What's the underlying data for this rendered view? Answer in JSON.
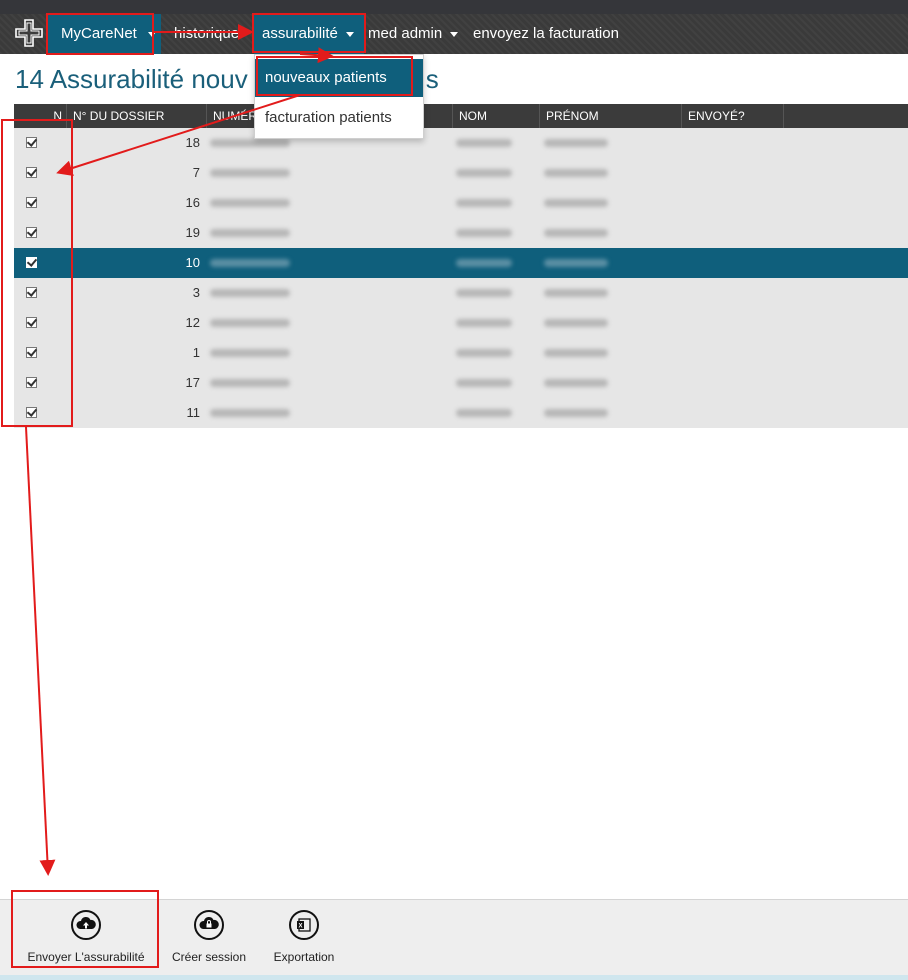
{
  "nav": {
    "brand": "MyCareNet",
    "items": [
      {
        "label": "historique"
      },
      {
        "label": "assurabilité"
      },
      {
        "label": "med admin"
      },
      {
        "label": "envoyez la facturation"
      }
    ]
  },
  "dropdown": {
    "items": [
      "nouveaux patients",
      "facturation patients"
    ]
  },
  "page_title": "14 Assurabilité nouv",
  "page_title_tail": "s",
  "table": {
    "columns": [
      "N",
      "N° DU DOSSIER",
      "NUMÉR",
      "NOM",
      "PRÉNOM",
      "ENVOYÉ?"
    ],
    "rows": [
      {
        "dossier": "18",
        "selected": false
      },
      {
        "dossier": "7",
        "selected": false
      },
      {
        "dossier": "16",
        "selected": false
      },
      {
        "dossier": "19",
        "selected": false
      },
      {
        "dossier": "10",
        "selected": true
      },
      {
        "dossier": "3",
        "selected": false
      },
      {
        "dossier": "12",
        "selected": false
      },
      {
        "dossier": "1",
        "selected": false
      },
      {
        "dossier": "17",
        "selected": false
      },
      {
        "dossier": "11",
        "selected": false
      }
    ]
  },
  "toolbar": {
    "send": "Envoyer L'assurabilité",
    "session": "Créer session",
    "export": "Exportation"
  },
  "colors": {
    "accent": "#0f5f7c",
    "annotation": "#e21b1b",
    "navbar": "#3a3a3a"
  }
}
